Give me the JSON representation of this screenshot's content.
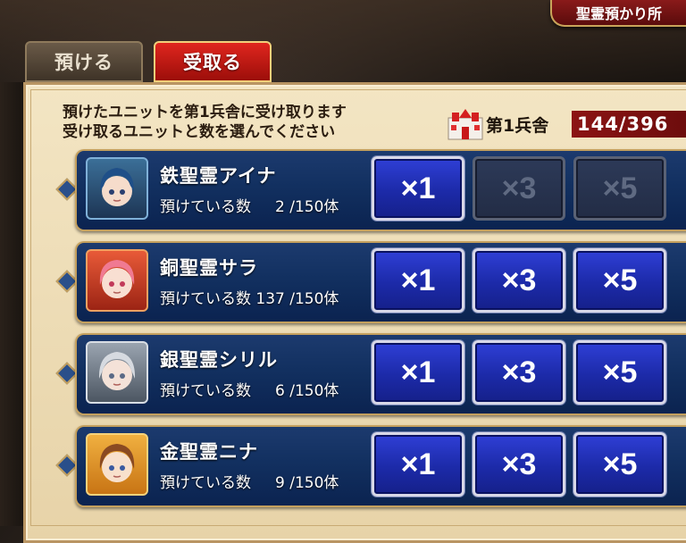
{
  "header": {
    "title": "聖霊預かり所"
  },
  "tabs": [
    {
      "label": "預ける",
      "active": false
    },
    {
      "label": "受取る",
      "active": true
    }
  ],
  "instructions": {
    "line1": "預けたユニットを第1兵舎に受け取ります",
    "line2": "受け取るユニットと数を選んでください"
  },
  "barracks": {
    "label": "第1兵舎",
    "count": "144/396"
  },
  "count_label": "預けている数",
  "multiplier_labels": [
    "×1",
    "×3",
    "×5"
  ],
  "units": [
    {
      "name": "鉄聖霊アイナ",
      "count_text": "2 /150体",
      "deposited": 2,
      "capacity": 150,
      "enabled": [
        true,
        false,
        false
      ],
      "avatar": "blue-hair-spirit-avatar"
    },
    {
      "name": "銅聖霊サラ",
      "count_text": "137 /150体",
      "deposited": 137,
      "capacity": 150,
      "enabled": [
        true,
        true,
        true
      ],
      "avatar": "pink-hair-spirit-avatar"
    },
    {
      "name": "銀聖霊シリル",
      "count_text": "6 /150体",
      "deposited": 6,
      "capacity": 150,
      "enabled": [
        true,
        true,
        true
      ],
      "avatar": "silver-hair-spirit-avatar"
    },
    {
      "name": "金聖霊ニナ",
      "count_text": "9 /150体",
      "deposited": 9,
      "capacity": 150,
      "enabled": [
        true,
        true,
        true
      ],
      "avatar": "brown-hair-spirit-avatar"
    }
  ],
  "colors": {
    "row_bg": "#123060",
    "button_active": "#1c2aa8",
    "button_disabled": "#2d3a58",
    "tab_active": "#c0170f",
    "count_bar": "#7a1010"
  }
}
